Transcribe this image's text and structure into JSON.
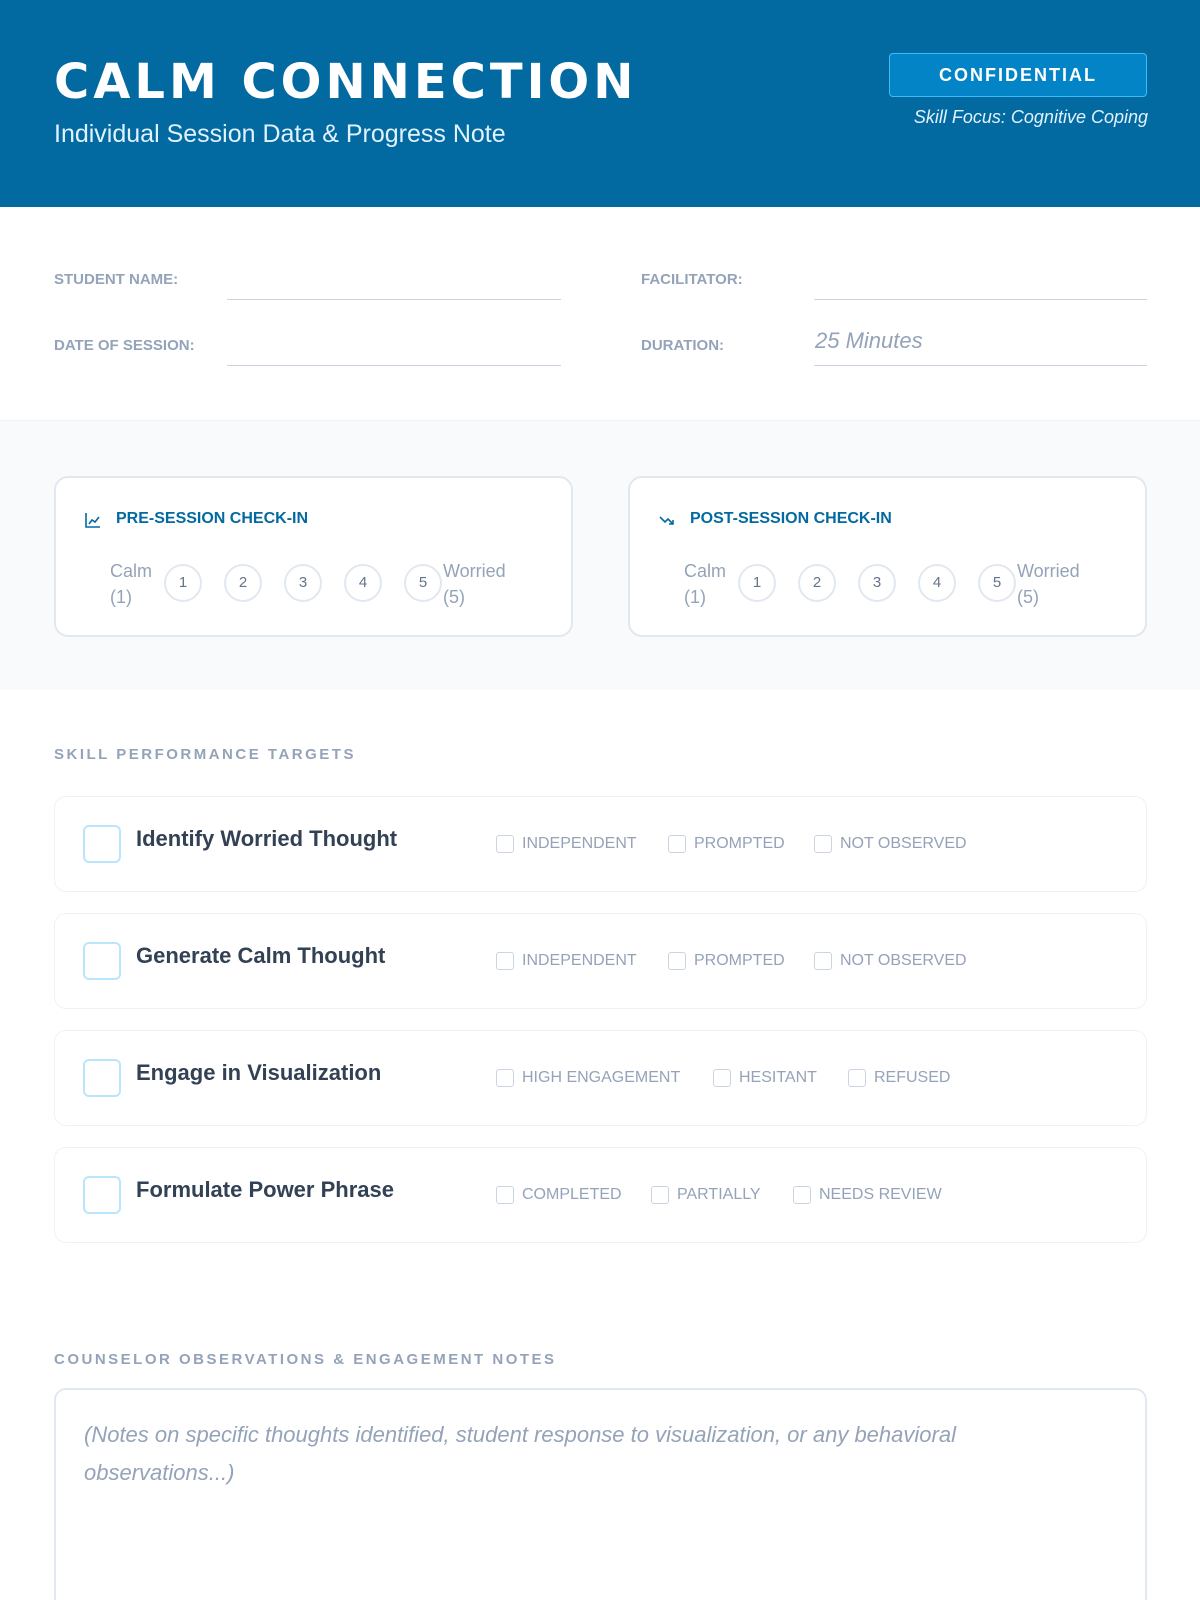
{
  "header": {
    "title": "CALM CONNECTION",
    "subtitle": "Individual Session Data & Progress Note",
    "badge": "CONFIDENTIAL",
    "skill_focus": "Skill Focus: Cognitive Coping",
    "background_color": "#0369a1"
  },
  "fields": {
    "student_name": {
      "label": "STUDENT NAME:",
      "value": ""
    },
    "facilitator": {
      "label": "FACILITATOR:",
      "value": ""
    },
    "date_of_session": {
      "label": "DATE OF SESSION:",
      "value": ""
    },
    "duration": {
      "label": "DURATION:",
      "value": "25 Minutes"
    }
  },
  "checkins": [
    {
      "title": "PRE-SESSION CHECK-IN",
      "icon": "chart-line-up-icon",
      "low_label": "Calm (1)",
      "high_label": "Worried (5)",
      "scale": [
        "1",
        "2",
        "3",
        "4",
        "5"
      ]
    },
    {
      "title": "POST-SESSION CHECK-IN",
      "icon": "trend-down-icon",
      "low_label": "Calm (1)",
      "high_label": "Worried (5)",
      "scale": [
        "1",
        "2",
        "3",
        "4",
        "5"
      ]
    }
  ],
  "skills": {
    "heading": "SKILL PERFORMANCE TARGETS",
    "items": [
      {
        "name": "Identify Worried Thought",
        "options": [
          "INDEPENDENT",
          "PROMPTED",
          "NOT OBSERVED"
        ]
      },
      {
        "name": "Generate Calm Thought",
        "options": [
          "INDEPENDENT",
          "PROMPTED",
          "NOT OBSERVED"
        ]
      },
      {
        "name": "Engage in Visualization",
        "options": [
          "HIGH ENGAGEMENT",
          "HESITANT",
          "REFUSED"
        ]
      },
      {
        "name": "Formulate Power Phrase",
        "options": [
          "COMPLETED",
          "PARTIALLY",
          "NEEDS REVIEW"
        ]
      }
    ]
  },
  "notes": {
    "heading": "COUNSELOR OBSERVATIONS & ENGAGEMENT NOTES",
    "placeholder": "(Notes on specific thoughts identified, student response to visualization, or any behavioral observations...)"
  }
}
